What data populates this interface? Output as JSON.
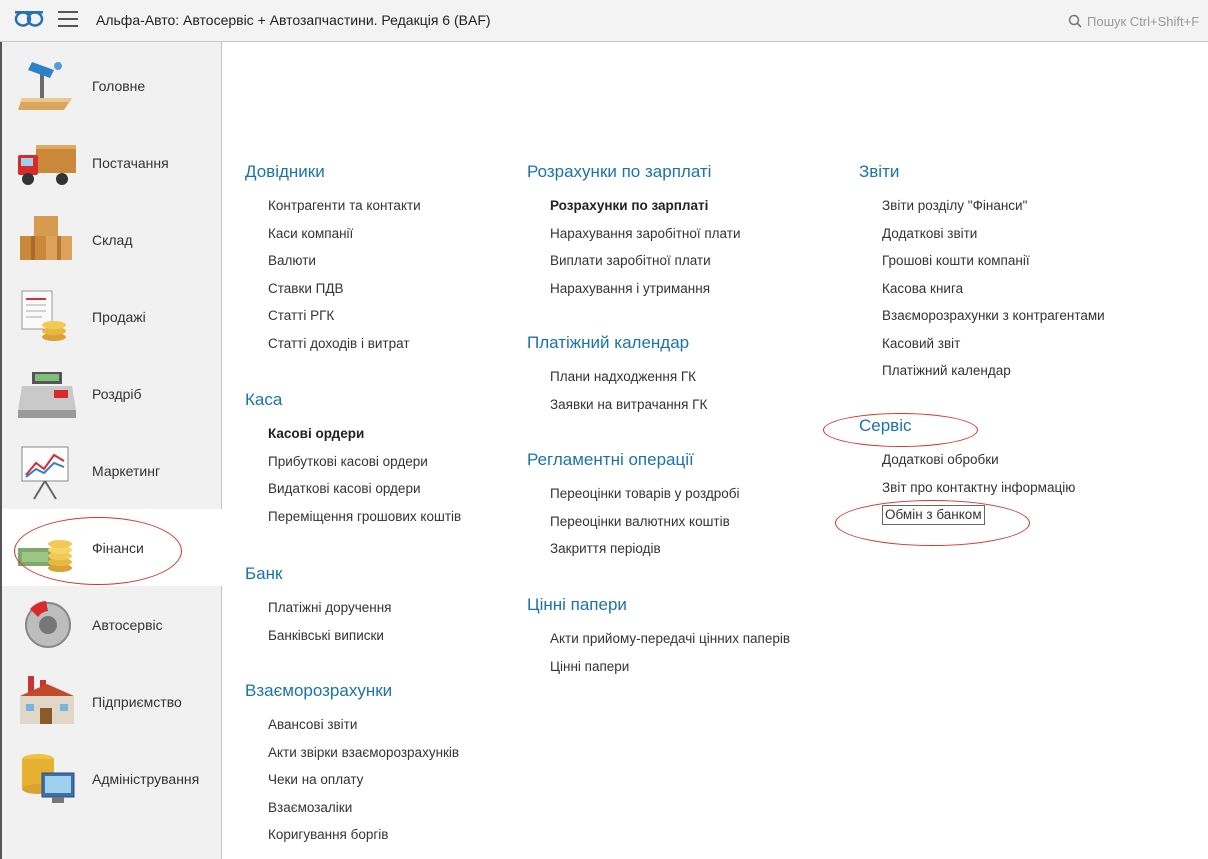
{
  "titlebar": {
    "title": "Альфа-Авто: Автосервіс + Автозапчастини. Редакція 6  (BAF)",
    "search_placeholder": "Пошук Ctrl+Shift+F"
  },
  "sidebar": {
    "items": [
      {
        "label": "Головне",
        "icon": "desk-lamp-icon"
      },
      {
        "label": "Постачання",
        "icon": "truck-icon"
      },
      {
        "label": "Склад",
        "icon": "boxes-icon"
      },
      {
        "label": "Продажі",
        "icon": "invoice-coins-icon"
      },
      {
        "label": "Роздріб",
        "icon": "cash-register-icon"
      },
      {
        "label": "Маркетинг",
        "icon": "chart-easel-icon"
      },
      {
        "label": "Фінанси",
        "icon": "money-coins-icon",
        "active": true
      },
      {
        "label": "Автосервіс",
        "icon": "brake-disc-icon"
      },
      {
        "label": "Підприємство",
        "icon": "factory-icon"
      },
      {
        "label": "Адміністрування",
        "icon": "database-monitor-icon"
      }
    ]
  },
  "columns": [
    {
      "groups": [
        {
          "title": "Довідники",
          "links": [
            "Контрагенти та контакти",
            "Каси компанії",
            "Валюти",
            "Ставки ПДВ",
            "Статті РГК",
            "Статті доходів і витрат"
          ]
        },
        {
          "title": "Каса",
          "links": [
            "Касові ордери",
            "Прибуткові касові ордери",
            "Видаткові касові ордери",
            "Переміщення грошових коштів"
          ]
        },
        {
          "title": "Банк",
          "links": [
            "Платіжні доручення",
            "Банківські виписки"
          ]
        },
        {
          "title": "Взаєморозрахунки",
          "links": [
            "Авансові звіти",
            "Акти звірки взаєморозрахунків",
            "Чеки на оплату",
            "Взаємозаліки",
            "Коригування боргів"
          ]
        }
      ]
    },
    {
      "groups": [
        {
          "title": "Розрахунки по зарплаті",
          "links": [
            "Розрахунки по зарплаті",
            "Нарахування заробітної плати",
            "Виплати заробітної плати",
            "Нарахування і утримання"
          ]
        },
        {
          "title": "Платіжний календар",
          "links": [
            "Плани надходження ГК",
            "Заявки на витрачання ГК"
          ]
        },
        {
          "title": "Регламентні операції",
          "links": [
            "Переоцінки товарів у роздробі",
            "Переоцінки валютних коштів",
            "Закриття періодів"
          ]
        },
        {
          "title": "Цінні папери",
          "links": [
            "Акти прийому-передачі цінних паперів",
            "Цінні папери"
          ]
        }
      ]
    },
    {
      "groups": [
        {
          "title": "Звіти",
          "links": [
            "Звіти розділу \"Фінанси\"",
            "Додаткові звіти",
            "Грошові кошти компанії",
            "Касова книга",
            "Взаєморозрахунки з контрагентами",
            "Касовий звіт",
            "Платіжний календар"
          ]
        },
        {
          "title": "Сервіс",
          "links": [
            "Додаткові обробки",
            "Звіт про контактну інформацію",
            "Обмін з банком"
          ]
        }
      ]
    }
  ],
  "colors": {
    "link_title": "#1a73ad",
    "annotation": "#d9322b"
  }
}
